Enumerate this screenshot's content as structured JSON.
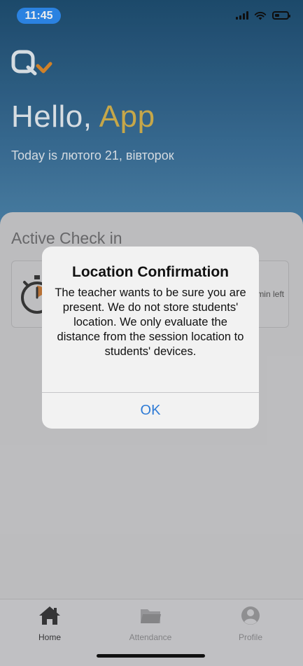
{
  "status_bar": {
    "time": "11:45",
    "icons": [
      "cellular-signal-icon",
      "wifi-icon",
      "battery-low-icon"
    ]
  },
  "header": {
    "logo": "app-logo",
    "greeting": "Hello,",
    "user_name": "App",
    "today_text": "Today is лютого 21, вівторок"
  },
  "active_check_in": {
    "title": "Active Check in",
    "time_left_fragment": "min left",
    "icon": "stopwatch-icon"
  },
  "dialog": {
    "title": "Location Confirmation",
    "message": "The teacher wants to be sure you are present. We do not store students' location. We only evaluate the distance from the session location to students' devices.",
    "ok_label": "OK"
  },
  "tab_bar": {
    "tabs": [
      {
        "label": "Home",
        "icon": "home-icon",
        "active": true
      },
      {
        "label": "Attendance",
        "icon": "folder-icon",
        "active": false
      },
      {
        "label": "Profile",
        "icon": "profile-icon",
        "active": false
      }
    ]
  },
  "colors": {
    "header_top": "#1f4f73",
    "header_bottom": "#4e86ad",
    "accent_name": "#d6b44f",
    "time_pill": "#2f8cf3",
    "ok_blue": "#2e7bd6"
  }
}
